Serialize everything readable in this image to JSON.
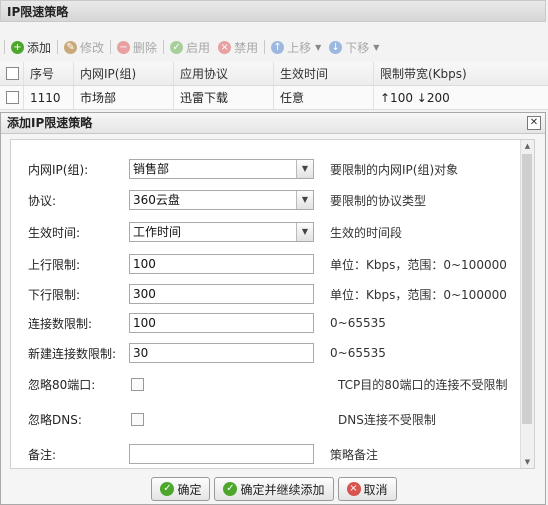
{
  "panel": {
    "title": "IP限速策略"
  },
  "toolbar": {
    "add": "添加",
    "edit": "修改",
    "delete": "删除",
    "enable": "启用",
    "disable": "禁用",
    "up": "上移",
    "down": "下移"
  },
  "grid": {
    "columns": [
      "序号",
      "内网IP(组)",
      "应用协议",
      "生效时间",
      "限制带宽(Kbps)"
    ],
    "rows": [
      {
        "id": "1110",
        "ip": "市场部",
        "protocol": "迅雷下载",
        "time": "任意",
        "bandwidth": "↑100 ↓200"
      }
    ]
  },
  "dialog": {
    "title": "添加IP限速策略",
    "fields": {
      "ip_group": {
        "label": "内网IP(组):",
        "value": "销售部",
        "hint": "要限制的内网IP(组)对象"
      },
      "protocol": {
        "label": "协议:",
        "value": "360云盘",
        "hint": "要限制的协议类型"
      },
      "schedule": {
        "label": "生效时间:",
        "value": "工作时间",
        "hint": "生效的时间段"
      },
      "up_limit": {
        "label": "上行限制:",
        "value": "100",
        "hint": "单位：Kbps，范围：0~100000"
      },
      "down_limit": {
        "label": "下行限制:",
        "value": "300",
        "hint": "单位：Kbps，范围：0~100000"
      },
      "conn_limit": {
        "label": "连接数限制:",
        "value": "100",
        "hint": "0~65535"
      },
      "new_conn_limit": {
        "label": "新建连接数限制:",
        "value": "30",
        "hint": "0~65535"
      },
      "ignore_80": {
        "label": "忽略80端口:",
        "hint": "TCP目的80端口的连接不受限制"
      },
      "ignore_dns": {
        "label": "忽略DNS:",
        "hint": "DNS连接不受限制"
      },
      "remark": {
        "label": "备注:",
        "value": "",
        "hint": "策略备注"
      }
    },
    "buttons": {
      "ok": "确定",
      "ok_continue": "确定并继续添加",
      "cancel": "取消"
    }
  },
  "colors": {
    "green": "#4ca72c",
    "red": "#d9534f",
    "blue": "#3a7bd5"
  }
}
